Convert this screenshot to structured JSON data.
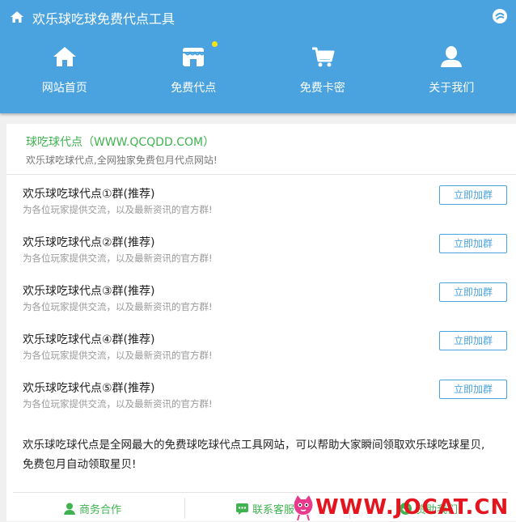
{
  "header": {
    "title": "欢乐球吃球免费代点工具",
    "nav": [
      {
        "label": "网站首页",
        "icon": "home-icon"
      },
      {
        "label": "免费代点",
        "icon": "shop-icon",
        "badge": true
      },
      {
        "label": "免费卡密",
        "icon": "cart-icon"
      },
      {
        "label": "关于我们",
        "icon": "user-icon"
      }
    ]
  },
  "site": {
    "title": "球吃球代点（WWW.QCQDD.COM）",
    "desc": "欢乐球吃球代点,全网独家免费包月代点网站!"
  },
  "groups": [
    {
      "name": "欢乐球吃球代点①群(推荐)",
      "desc": "为各位玩家提供交流，以及最新资讯的官方群!",
      "button": "立即加群"
    },
    {
      "name": "欢乐球吃球代点②群(推荐)",
      "desc": "为各位玩家提供交流，以及最新资讯的官方群!",
      "button": "立即加群"
    },
    {
      "name": "欢乐球吃球代点③群(推荐)",
      "desc": "为各位玩家提供交流，以及最新资讯的官方群!",
      "button": "立即加群"
    },
    {
      "name": "欢乐球吃球代点④群(推荐)",
      "desc": "为各位玩家提供交流，以及最新资讯的官方群!",
      "button": "立即加群"
    },
    {
      "name": "欢乐球吃球代点⑤群(推荐)",
      "desc": "为各位玩家提供交流，以及最新资讯的官方群!",
      "button": "立即加群"
    }
  ],
  "about": "欢乐球吃球代点是全网最大的免费球吃球代点工具网站，可以帮助大家瞬间领取欢乐球吃球星贝,免费包月自动领取星贝!",
  "footer": {
    "business": "商务合作",
    "service": "联系客服",
    "sponsor": "赞助我们"
  },
  "watermark": "WWW.JOCAT.CN",
  "colors": {
    "header": "#4aa3df",
    "green": "#3fb34f",
    "badge": "#f5e31a",
    "watermark": "#e4151f"
  }
}
